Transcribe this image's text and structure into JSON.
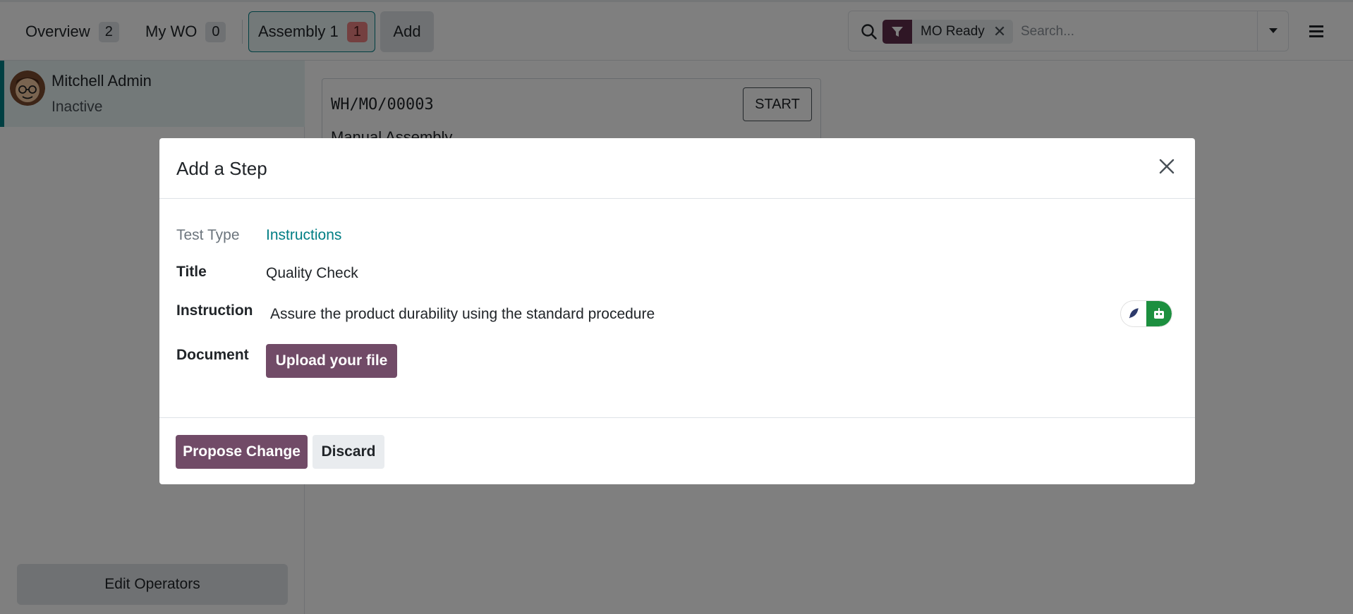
{
  "topbar": {
    "tabs": [
      {
        "label": "Overview",
        "count": "2"
      },
      {
        "label": "My WO",
        "count": "0"
      },
      {
        "label": "Assembly 1",
        "count": "1"
      }
    ],
    "add_label": "Add",
    "search": {
      "facet_label": "MO Ready",
      "placeholder": "Search..."
    }
  },
  "sidebar": {
    "operator_name": "Mitchell Admin",
    "operator_status": "Inactive",
    "edit_operators_label": "Edit Operators"
  },
  "workorder": {
    "reference": "WH/MO/00003",
    "start_label": "START",
    "name": "Manual Assembly"
  },
  "modal": {
    "title": "Add a Step",
    "fields": {
      "test_type_label": "Test Type",
      "test_type_value": "Instructions",
      "title_label": "Title",
      "title_value": "Quality Check",
      "instruction_label": "Instruction",
      "instruction_value": "Assure the product durability using the standard procedure",
      "document_label": "Document",
      "upload_label": "Upload your file"
    },
    "footer": {
      "propose_label": "Propose Change",
      "discard_label": "Discard"
    }
  },
  "colors": {
    "primary": "#714b67",
    "accent": "#017e84",
    "facet": "#5f2c4a",
    "ai_green": "#1c8f3f"
  }
}
